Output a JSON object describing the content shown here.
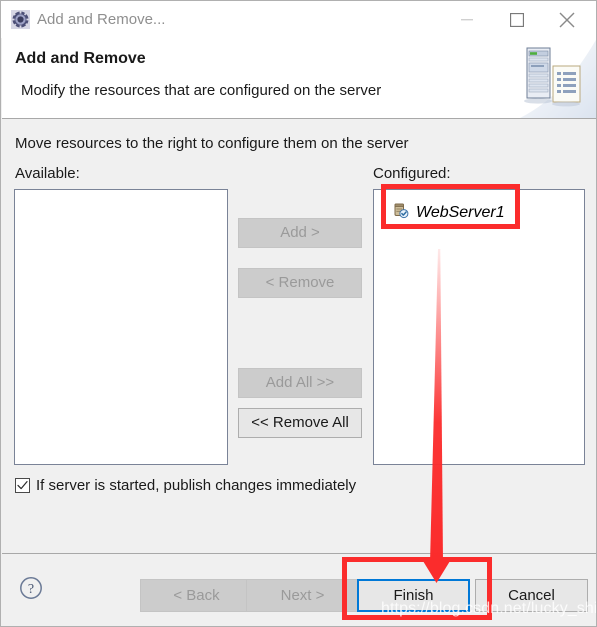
{
  "window": {
    "title": "Add and Remove...",
    "icon": "gear-icon",
    "controls": {
      "minimize": "minimize-icon",
      "maximize": "maximize-icon",
      "close": "close-icon"
    }
  },
  "header": {
    "title": "Add and Remove",
    "subtitle": "Modify the resources that are configured on the server",
    "art": "server-and-document-icon"
  },
  "main": {
    "instruction": "Move resources to the right to configure them on the server",
    "available": {
      "label": "Available:",
      "items": []
    },
    "configured": {
      "label": "Configured:",
      "items": [
        {
          "label": "WebServer1",
          "icon": "server-resource-icon"
        }
      ]
    },
    "transfer_buttons": [
      {
        "label": "Add >",
        "enabled": false
      },
      {
        "label": "< Remove",
        "enabled": false
      },
      {
        "label": "Add All >>",
        "enabled": false
      },
      {
        "label": "<< Remove All",
        "enabled": true
      }
    ],
    "checkbox": {
      "label": "If server is started, publish changes immediately",
      "checked": true
    }
  },
  "footer": {
    "help": "help-icon",
    "buttons": [
      {
        "label": "< Back",
        "enabled": false
      },
      {
        "label": "Next >",
        "enabled": false
      },
      {
        "label": "Finish",
        "enabled": true,
        "focused": true
      },
      {
        "label": "Cancel",
        "enabled": true
      }
    ]
  },
  "annotations": {
    "highlight_color": "#fb2c2c",
    "highlight_targets": [
      "WebServer1",
      "Finish"
    ],
    "arrow": "red-arrow-pointing-to-finish",
    "watermark": "https://blog.csdn.net/lucky_shi"
  },
  "colors": {
    "accent": "#0078d7",
    "highlight": "#fb2c2c",
    "window_bg": "#f0f0f0",
    "list_bg": "#ffffff"
  }
}
